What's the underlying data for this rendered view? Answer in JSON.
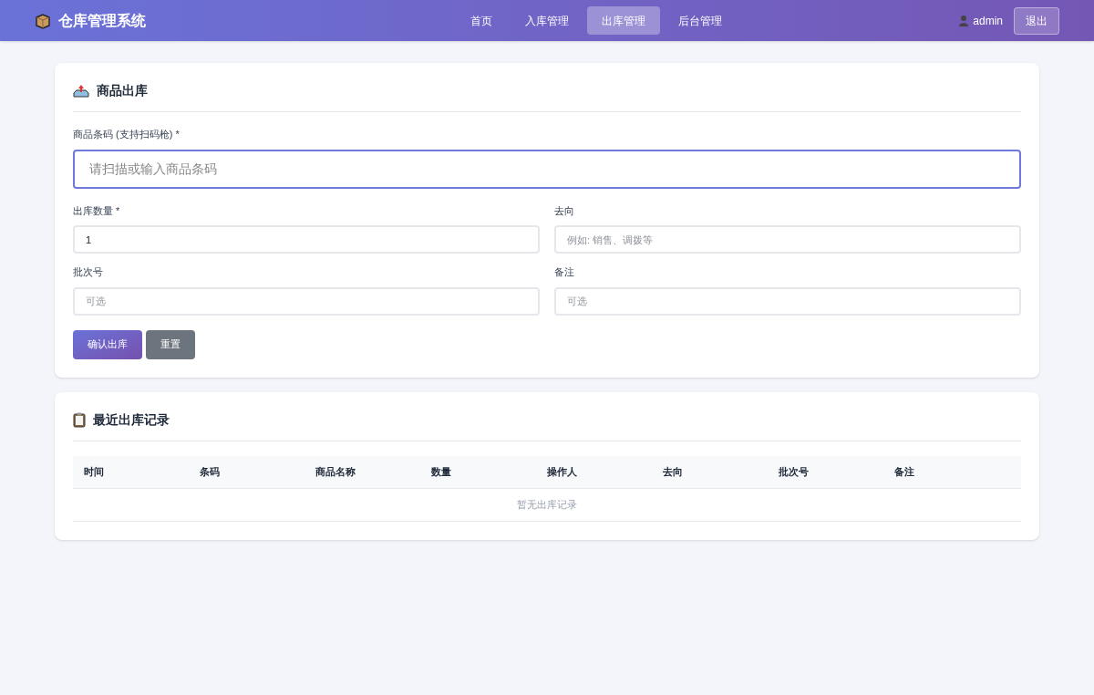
{
  "header": {
    "title": "仓库管理系统",
    "nav": [
      {
        "label": "首页",
        "selected": false
      },
      {
        "label": "入库管理",
        "selected": false
      },
      {
        "label": "出库管理",
        "selected": true
      },
      {
        "label": "后台管理",
        "selected": false
      }
    ],
    "user": "admin",
    "logout": "退出"
  },
  "form": {
    "title": "商品出库",
    "barcode": {
      "label": "商品条码 (支持扫码枪) *",
      "placeholder": "请扫描或输入商品条码",
      "focused": true
    },
    "fields": [
      {
        "label": "出库数量 *",
        "value": "1"
      },
      {
        "label": "去向",
        "placeholder": "例如: 销售、调拨等"
      },
      {
        "label": "批次号",
        "placeholder": "可选"
      },
      {
        "label": "备注",
        "placeholder": "可选"
      }
    ],
    "submit": "确认出库",
    "reset": "重置"
  },
  "records": {
    "title": "最近出库记录",
    "columns": [
      "时间",
      "条码",
      "商品名称",
      "数量",
      "操作人",
      "去向",
      "批次号",
      "备注"
    ],
    "empty": "暂无出库记录"
  }
}
